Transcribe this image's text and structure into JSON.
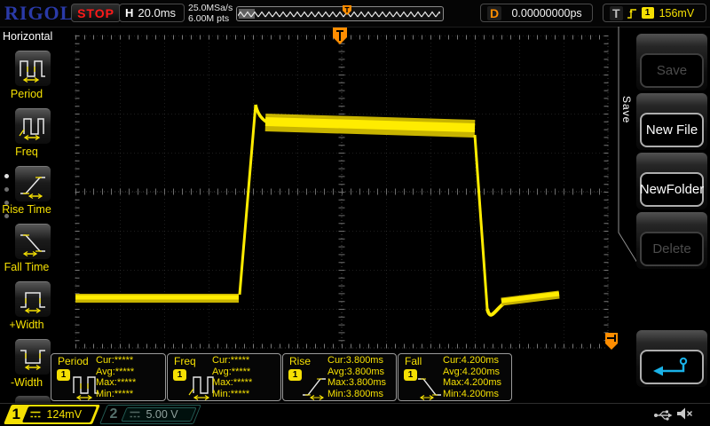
{
  "top_bar": {
    "logo": "RIGOL",
    "run_state": "STOP",
    "horizontal": {
      "label": "H",
      "timebase": "20.0ms"
    },
    "acquisition": {
      "sample_rate": "25.0MSa/s",
      "mem_depth": "6.00M pts"
    },
    "delay": {
      "label": "D",
      "value": "0.00000000ps"
    },
    "trigger": {
      "label": "T",
      "channel": "1",
      "level": "156mV",
      "slope_icon": "rising-edge-icon"
    }
  },
  "left_menu": {
    "title": "Horizontal",
    "items": [
      {
        "label": "Period",
        "icon": "period-icon"
      },
      {
        "label": "Freq",
        "icon": "freq-icon"
      },
      {
        "label": "Rise Time",
        "icon": "rise-time-icon"
      },
      {
        "label": "Fall Time",
        "icon": "fall-time-icon"
      },
      {
        "label": "+Width",
        "icon": "plus-width-icon"
      },
      {
        "label": "-Width",
        "icon": "minus-width-icon"
      }
    ]
  },
  "right_menu": {
    "title": "Save",
    "buttons": [
      {
        "label": "Save",
        "enabled": false
      },
      {
        "label": "New File",
        "enabled": true
      },
      {
        "label": "NewFolder",
        "enabled": true
      },
      {
        "label": "Delete",
        "enabled": false
      },
      {
        "label": "",
        "enabled": true,
        "icon": "return-arrow-icon"
      }
    ]
  },
  "measurements": [
    {
      "name": "Period",
      "channel": "1",
      "rows": [
        "Cur:*****",
        "Avg:*****",
        "Max:*****",
        "Min:*****"
      ]
    },
    {
      "name": "Freq",
      "channel": "1",
      "rows": [
        "Cur:*****",
        "Avg:*****",
        "Max:*****",
        "Min:*****"
      ]
    },
    {
      "name": "Rise",
      "channel": "1",
      "rows": [
        "Cur:3.800ms",
        "Avg:3.800ms",
        "Max:3.800ms",
        "Min:3.800ms"
      ]
    },
    {
      "name": "Fall",
      "channel": "1",
      "rows": [
        "Cur:4.200ms",
        "Avg:4.200ms",
        "Max:4.200ms",
        "Min:4.200ms"
      ]
    }
  ],
  "channels": [
    {
      "id": "1",
      "scale": "124mV",
      "active": true
    },
    {
      "id": "2",
      "scale": "5.00 V",
      "active": false
    }
  ],
  "status_icons": {
    "usb": "usb-host",
    "speaker": "muted"
  },
  "colors": {
    "accent_yellow": "#f5e003",
    "trace_yellow": "#ffec00",
    "accent_orange": "#ff8d00",
    "accent_cyan": "#1ab2e8",
    "stop_red": "#ff1a1a",
    "logo_blue": "#2a3aa8"
  }
}
